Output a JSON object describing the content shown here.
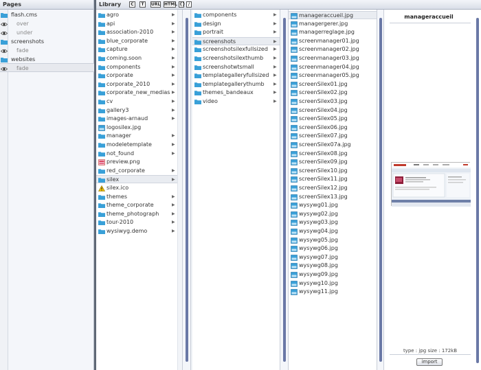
{
  "pages": {
    "title": "Pages",
    "rows": [
      {
        "label": "flash.cms",
        "icon": "page-icon",
        "child": false
      },
      {
        "label": "over",
        "icon": "eye-icon",
        "child": true
      },
      {
        "label": "under",
        "icon": "eye-icon",
        "child": true
      },
      {
        "label": "screenshots",
        "icon": "page-icon",
        "child": false
      },
      {
        "label": "fade",
        "icon": "eye-icon",
        "child": true
      },
      {
        "label": "websites",
        "icon": "page-icon",
        "child": false
      },
      {
        "label": "fade",
        "icon": "eye-icon",
        "child": true
      }
    ]
  },
  "library": {
    "title": "Library",
    "toolbar": [
      "C",
      "T",
      "URL",
      "HTML",
      "{}",
      "/"
    ]
  },
  "columns": [
    {
      "items": [
        {
          "name": "agro",
          "type": "folder"
        },
        {
          "name": "api",
          "type": "folder"
        },
        {
          "name": "association-2010",
          "type": "folder"
        },
        {
          "name": "blue_corporate",
          "type": "folder"
        },
        {
          "name": "capture",
          "type": "folder"
        },
        {
          "name": "coming.soon",
          "type": "folder"
        },
        {
          "name": "components",
          "type": "folder"
        },
        {
          "name": "corporate",
          "type": "folder"
        },
        {
          "name": "corporate_2010",
          "type": "folder"
        },
        {
          "name": "corporate_new_medias",
          "type": "folder"
        },
        {
          "name": "cv",
          "type": "folder"
        },
        {
          "name": "gallery3",
          "type": "folder"
        },
        {
          "name": "images-arnaud",
          "type": "folder"
        },
        {
          "name": "logosilex.jpg",
          "type": "image"
        },
        {
          "name": "manager",
          "type": "folder"
        },
        {
          "name": "modeletemplate",
          "type": "folder"
        },
        {
          "name": "not_found",
          "type": "folder"
        },
        {
          "name": "preview.png",
          "type": "png"
        },
        {
          "name": "red_corporate",
          "type": "folder"
        },
        {
          "name": "silex",
          "type": "folder",
          "selected": true
        },
        {
          "name": "silex.ico",
          "type": "warning"
        },
        {
          "name": "themes",
          "type": "folder"
        },
        {
          "name": "theme_corporate",
          "type": "folder"
        },
        {
          "name": "theme_photograph",
          "type": "folder"
        },
        {
          "name": "tour-2010",
          "type": "folder"
        },
        {
          "name": "wysiwyg.demo",
          "type": "folder"
        }
      ]
    },
    {
      "items": [
        {
          "name": "components",
          "type": "folder"
        },
        {
          "name": "design",
          "type": "folder"
        },
        {
          "name": "portrait",
          "type": "folder"
        },
        {
          "name": "screenshots",
          "type": "folder",
          "selected": true
        },
        {
          "name": "screenshotsilexfullsized",
          "type": "folder"
        },
        {
          "name": "screenshotsilexthumb",
          "type": "folder"
        },
        {
          "name": "screenshotwtsmall",
          "type": "folder"
        },
        {
          "name": "templategalleryfullsized",
          "type": "folder"
        },
        {
          "name": "templategallerythumb",
          "type": "folder"
        },
        {
          "name": "themes_bandeaux",
          "type": "folder"
        },
        {
          "name": "video",
          "type": "folder"
        }
      ]
    },
    {
      "items": [
        {
          "name": "manageraccueil.jpg",
          "type": "image",
          "selected": true
        },
        {
          "name": "managergerer.jpg",
          "type": "image"
        },
        {
          "name": "managerreglage.jpg",
          "type": "image"
        },
        {
          "name": "screenmanager01.jpg",
          "type": "image"
        },
        {
          "name": "screenmanager02.jpg",
          "type": "image"
        },
        {
          "name": "screenmanager03.jpg",
          "type": "image"
        },
        {
          "name": "screenmanager04.jpg",
          "type": "image"
        },
        {
          "name": "screenmanager05.jpg",
          "type": "image"
        },
        {
          "name": "screenSilex01.jpg",
          "type": "image"
        },
        {
          "name": "screenSilex02.jpg",
          "type": "image"
        },
        {
          "name": "screenSilex03.jpg",
          "type": "image"
        },
        {
          "name": "screenSilex04.jpg",
          "type": "image"
        },
        {
          "name": "screenSilex05.jpg",
          "type": "image"
        },
        {
          "name": "screenSilex06.jpg",
          "type": "image"
        },
        {
          "name": "screenSilex07.jpg",
          "type": "image"
        },
        {
          "name": "screenSilex07a.jpg",
          "type": "image"
        },
        {
          "name": "screenSilex08.jpg",
          "type": "image"
        },
        {
          "name": "screenSilex09.jpg",
          "type": "image"
        },
        {
          "name": "screenSilex10.jpg",
          "type": "image"
        },
        {
          "name": "screenSilex11.jpg",
          "type": "image"
        },
        {
          "name": "screenSilex12.jpg",
          "type": "image"
        },
        {
          "name": "screenSilex13.jpg",
          "type": "image"
        },
        {
          "name": "wysywg01.jpg",
          "type": "image"
        },
        {
          "name": "wysywg02.jpg",
          "type": "image"
        },
        {
          "name": "wysywg03.jpg",
          "type": "image"
        },
        {
          "name": "wysywg04.jpg",
          "type": "image"
        },
        {
          "name": "wysywg05.jpg",
          "type": "image"
        },
        {
          "name": "wysywg06.jpg",
          "type": "image"
        },
        {
          "name": "wysywg07.jpg",
          "type": "image"
        },
        {
          "name": "wysywg08.jpg",
          "type": "image"
        },
        {
          "name": "wysywg09.jpg",
          "type": "image"
        },
        {
          "name": "wysywg10.jpg",
          "type": "image"
        },
        {
          "name": "wysywg11.jpg",
          "type": "image"
        }
      ]
    }
  ],
  "preview": {
    "title": "manageraccueil",
    "meta": "type : jpg   size : 172kB",
    "import_label": "import"
  },
  "colors": {
    "folder": "#3aa0d8",
    "scrollbar": "#6a78a6",
    "splitter": "#5f6875"
  }
}
